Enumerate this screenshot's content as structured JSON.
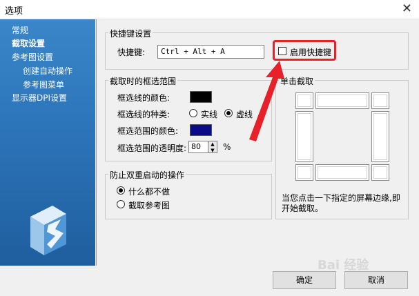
{
  "window": {
    "title": "选项",
    "close_glyph": "✕"
  },
  "sidebar": {
    "items": [
      {
        "label": "常规"
      },
      {
        "label": "截取设置"
      },
      {
        "label": "参考图设置"
      },
      {
        "label": "创建自动操作"
      },
      {
        "label": "参考图菜单"
      },
      {
        "label": "显示器DPI设置"
      }
    ]
  },
  "hotkey": {
    "group_title": "快捷键设置",
    "label": "快捷键:",
    "value": "Ctrl + Alt + A",
    "enable_label": "启用快捷键",
    "enabled": false
  },
  "selection": {
    "group_title": "截取时的框选范围",
    "line_color_label": "框选线的颜色:",
    "line_color": "#000000",
    "line_type_label": "框选线的种类:",
    "line_type_options": [
      "实线",
      "虚线"
    ],
    "line_type_selected": "虚线",
    "range_color_label": "框选范围的颜色:",
    "range_color": "#0a0a8a",
    "opacity_label": "框选范围的透明度:",
    "opacity_value": "80",
    "opacity_unit": "%"
  },
  "prevent": {
    "group_title": "防止双重启动的操作",
    "options": [
      "什么都不做",
      "截取参考图"
    ],
    "selected": "什么都不做"
  },
  "click_capture": {
    "group_title": "单击截取",
    "hint": "当您点击一下指定的屏幕边缘,即开始截取。"
  },
  "footer": {
    "ok": "确定",
    "cancel": "取消"
  },
  "watermark": "Bai 经验",
  "colors": {
    "highlight": "#e8202a",
    "sidebar": "#2f78bd"
  }
}
